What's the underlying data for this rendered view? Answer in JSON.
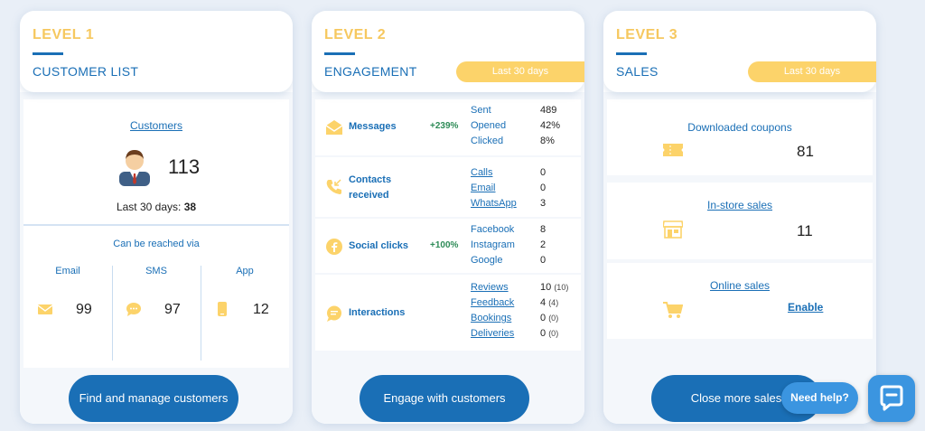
{
  "level1": {
    "level": "LEVEL 1",
    "title": "CUSTOMER LIST",
    "customers_link": "Customers",
    "customer_count": "113",
    "last30_label": "Last 30 days:",
    "last30_value": "38",
    "reach_label": "Can be reached via",
    "channels": [
      {
        "label": "Email",
        "value": "99",
        "icon": "envelope-icon"
      },
      {
        "label": "SMS",
        "value": "97",
        "icon": "chat-bubble-icon"
      },
      {
        "label": "App",
        "value": "12",
        "icon": "phone-icon"
      }
    ],
    "cta": "Find and manage customers"
  },
  "level2": {
    "level": "LEVEL 2",
    "title": "ENGAGEMENT",
    "period": "Last 30 days",
    "rows": [
      {
        "label": "Messages",
        "pct": "+239%",
        "icon": "envelope-open-icon",
        "items": [
          {
            "name": "Sent",
            "value": "489"
          },
          {
            "name": "Opened",
            "value": "42%"
          },
          {
            "name": "Clicked",
            "value": "8%"
          }
        ]
      },
      {
        "label": "Contacts received",
        "pct": "",
        "icon": "phone-incoming-icon",
        "items": [
          {
            "name": "Calls",
            "value": "0"
          },
          {
            "name": "Email",
            "value": "0"
          },
          {
            "name": "WhatsApp",
            "value": "3"
          }
        ]
      },
      {
        "label": "Social clicks",
        "pct": "+100%",
        "icon": "facebook-icon",
        "items": [
          {
            "name": "Facebook",
            "value": "8"
          },
          {
            "name": "Instagram",
            "value": "2"
          },
          {
            "name": "Google",
            "value": "0"
          }
        ]
      },
      {
        "label": "Interactions",
        "pct": "",
        "icon": "speech-bubble-icon",
        "items": [
          {
            "name": "Reviews",
            "value": "10",
            "sub": "(10)"
          },
          {
            "name": "Feedback",
            "value": "4",
            "sub": "(4)"
          },
          {
            "name": "Bookings",
            "value": "0",
            "sub": "(0)"
          },
          {
            "name": "Deliveries",
            "value": "0",
            "sub": "(0)"
          }
        ]
      }
    ],
    "cta": "Engage with customers"
  },
  "level3": {
    "level": "LEVEL 3",
    "title": "SALES",
    "period": "Last 30 days",
    "coupons_label": "Downloaded coupons",
    "coupons_value": "81",
    "instore_label": "In-store sales",
    "instore_value": "11",
    "online_label": "Online sales",
    "online_action": "Enable",
    "cta": "Close more sales"
  },
  "help": {
    "label": "Need help?"
  },
  "colors": {
    "accent": "#1a6fb6",
    "highlight": "#f6c85f",
    "pill": "#fcd36a",
    "positive": "#2e8b57",
    "help": "#3b95e0"
  }
}
